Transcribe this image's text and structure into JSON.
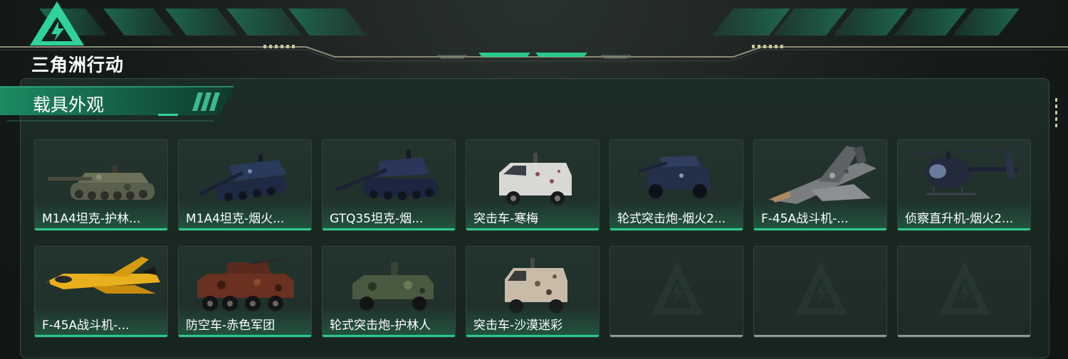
{
  "app": {
    "logo_text": "三角洲行动"
  },
  "panel": {
    "title": "载具外观"
  },
  "colors": {
    "accent": "#29c98a",
    "empty_bar": "#8e9894",
    "panel_bg": "#1c2c26"
  },
  "items": [
    {
      "label": "M1A4坦克-护林...",
      "icon": "tank-icon"
    },
    {
      "label": "M1A4坦克-烟火...",
      "icon": "tank-icon"
    },
    {
      "label": "GTQ35坦克-烟...",
      "icon": "tank-icon"
    },
    {
      "label": "突击车-寒梅",
      "icon": "armored-car-icon"
    },
    {
      "label": "轮式突击炮-烟火2...",
      "icon": "wheeled-gun-icon"
    },
    {
      "label": "F-45A战斗机-...",
      "icon": "jet-icon"
    },
    {
      "label": "侦察直升机-烟火2...",
      "icon": "helicopter-icon"
    },
    {
      "label": "F-45A战斗机-...",
      "icon": "jet-icon"
    },
    {
      "label": "防空车-赤色军团",
      "icon": "aa-vehicle-icon"
    },
    {
      "label": "轮式突击炮-护林人",
      "icon": "wheeled-gun-icon"
    },
    {
      "label": "突击车-沙漠迷彩",
      "icon": "armored-car-icon"
    },
    {
      "label": "",
      "icon": "empty-slot-icon"
    },
    {
      "label": "",
      "icon": "empty-slot-icon"
    },
    {
      "label": "",
      "icon": "empty-slot-icon"
    }
  ]
}
